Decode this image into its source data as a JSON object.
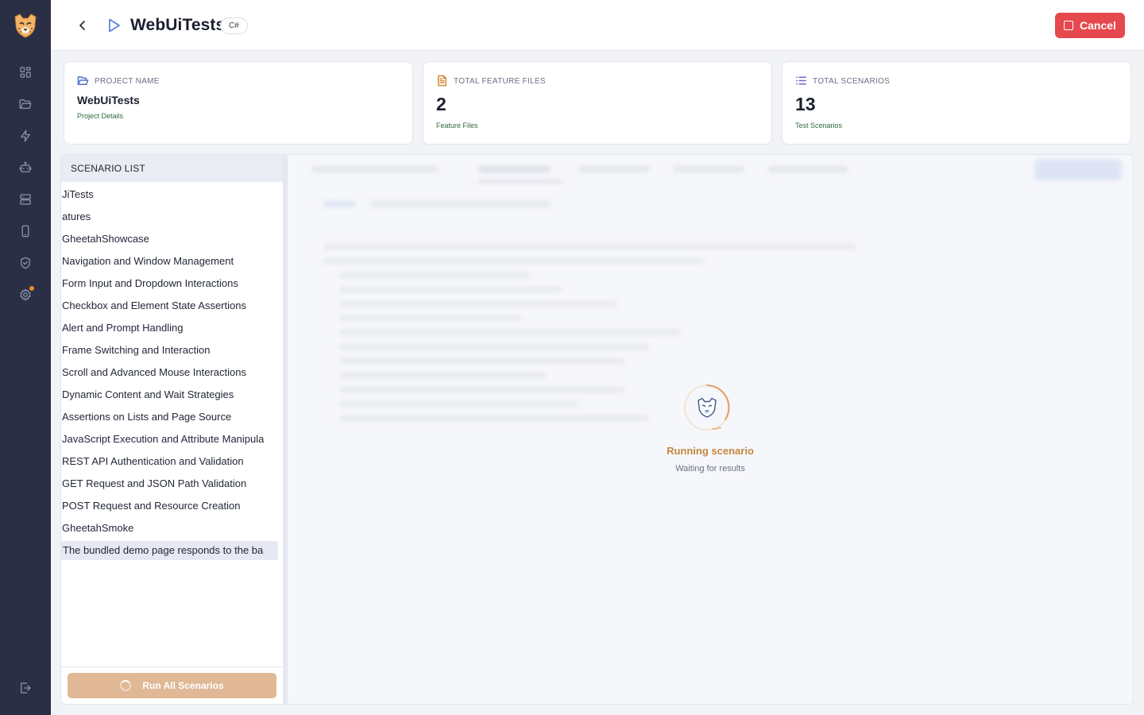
{
  "sidebar": {
    "items": [
      {
        "icon": "dashboard-icon"
      },
      {
        "icon": "folder-icon"
      },
      {
        "icon": "lightning-icon"
      },
      {
        "icon": "robot-icon"
      },
      {
        "icon": "server-icon"
      },
      {
        "icon": "mobile-icon"
      },
      {
        "icon": "shield-icon"
      },
      {
        "icon": "settings-icon",
        "has_notification": true
      }
    ],
    "logout_icon": "logout-icon"
  },
  "header": {
    "title": "WebUiTests",
    "language_badge": "C#",
    "cancel_label": "Cancel",
    "accent_color": "#e5484d"
  },
  "cards": [
    {
      "label": "PROJECT NAME",
      "value": "WebUiTests",
      "sub": "Project Details",
      "icon": "folder-open-icon"
    },
    {
      "label": "TOTAL FEATURE FILES",
      "value": "2",
      "sub": "Feature Files",
      "icon": "file-text-icon"
    },
    {
      "label": "TOTAL SCENARIOS",
      "value": "13",
      "sub": "Test Scenarios",
      "icon": "list-icon"
    }
  ],
  "scenario_list": {
    "header": "SCENARIO LIST",
    "items": [
      "JiTests",
      "atures",
      "GheetahShowcase",
      "Navigation and Window Management",
      "Form Input and Dropdown Interactions",
      "Checkbox and Element State Assertions",
      "Alert and Prompt Handling",
      "Frame Switching and Interaction",
      "Scroll and Advanced Mouse Interactions",
      "Dynamic Content and Wait Strategies",
      "Assertions on Lists and Page Source",
      "JavaScript Execution and Attribute Manipula",
      "REST API Authentication and Validation",
      "GET Request and JSON Path Validation",
      "POST Request and Resource Creation",
      "GheetahSmoke",
      "The bundled demo page responds to the ba"
    ],
    "selected_index": 16,
    "run_all_label": "Run All Scenarios"
  },
  "status": {
    "title": "Running scenario",
    "subtitle": "Waiting for results",
    "color": "#c58640"
  }
}
